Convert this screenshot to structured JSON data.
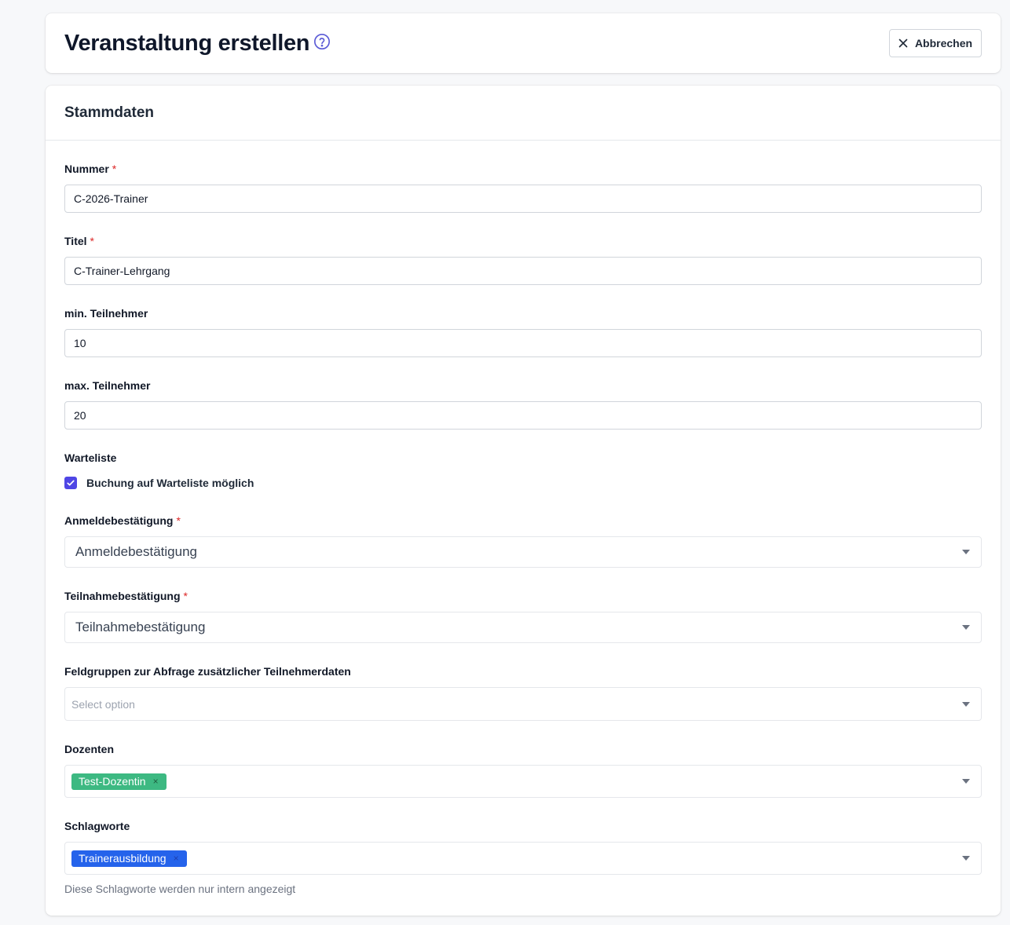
{
  "header": {
    "title": "Veranstaltung erstellen",
    "cancel_label": "Abbrechen"
  },
  "section": {
    "title": "Stammdaten"
  },
  "fields": {
    "nummer": {
      "label": "Nummer",
      "required_mark": "*",
      "value": "C-2026-Trainer"
    },
    "titel": {
      "label": "Titel",
      "required_mark": "*",
      "value": "C-Trainer-Lehrgang"
    },
    "min_teilnehmer": {
      "label": "min. Teilnehmer",
      "value": "10"
    },
    "max_teilnehmer": {
      "label": "max. Teilnehmer",
      "value": "20"
    },
    "warteliste": {
      "label": "Warteliste",
      "checkbox_label": "Buchung auf Warteliste möglich",
      "checked": true
    },
    "anmeldebestaetigung": {
      "label": "Anmeldebestätigung",
      "required_mark": "*",
      "value": "Anmeldebestätigung"
    },
    "teilnahmebestaetigung": {
      "label": "Teilnahmebestätigung",
      "required_mark": "*",
      "value": "Teilnahmebestätigung"
    },
    "feldgruppen": {
      "label": "Feldgruppen zur Abfrage zusätzlicher Teilnehmerdaten",
      "placeholder": "Select option"
    },
    "dozenten": {
      "label": "Dozenten",
      "tags": [
        "Test-Dozentin"
      ],
      "tag_remove": "×"
    },
    "schlagworte": {
      "label": "Schlagworte",
      "tags": [
        "Trainerausbildung"
      ],
      "tag_remove": "×",
      "hint": "Diese Schlagworte werden nur intern angezeigt"
    }
  },
  "colors": {
    "accent": "#4f46e5",
    "dozenten_tag": "#3db982",
    "schlagworte_tag": "#2563eb",
    "required": "#dc2626"
  },
  "icons": {
    "help": "question-circle-icon",
    "cancel": "close-icon",
    "check": "check-icon",
    "dropdown": "caret-down-icon"
  }
}
